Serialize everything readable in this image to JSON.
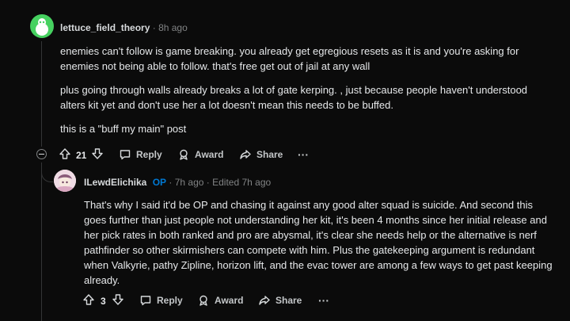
{
  "comment1": {
    "username": "lettuce_field_theory",
    "time": "8h ago",
    "paragraphs": [
      "enemies can't follow is game breaking. you already get egregious resets as it is and you're asking for enemies not being able to follow. that's free get out of jail at any wall",
      "plus going through walls already breaks a lot of gate kerping. , just because people haven't understood alters kit yet and don't use her a lot doesn't mean this needs to be buffed.",
      "this is a \"buff my main\" post"
    ],
    "votes": "21",
    "reply_label": "Reply",
    "award_label": "Award",
    "share_label": "Share",
    "more_label": "···"
  },
  "comment2": {
    "username": "ILewdElichika",
    "op_badge": "OP",
    "time": "7h ago",
    "edited": "Edited 7h ago",
    "text": "That's why I said it'd be OP and chasing it against any good alter squad is suicide. And second this goes further than just people not understanding her kit, it's been 4 months since her initial release and her pick rates in both ranked and pro are abysmal, it's clear she needs help or the alternative is nerf pathfinder so other skirmishers can compete with him. Plus the gatekeeping argument is redundant when Valkyrie, pathy Zipline, horizon lift, and the evac tower are among a few ways to get past keeping already.",
    "votes": "3",
    "reply_label": "Reply",
    "award_label": "Award",
    "share_label": "Share",
    "more_label": "···"
  },
  "icons": [
    "upvote-icon",
    "downvote-icon",
    "reply-icon",
    "award-icon",
    "share-icon",
    "more-icon",
    "collapse-icon"
  ],
  "colors": {
    "background": "#0b0b0b",
    "op": "#0079d3",
    "avatar1": "#46d160"
  }
}
